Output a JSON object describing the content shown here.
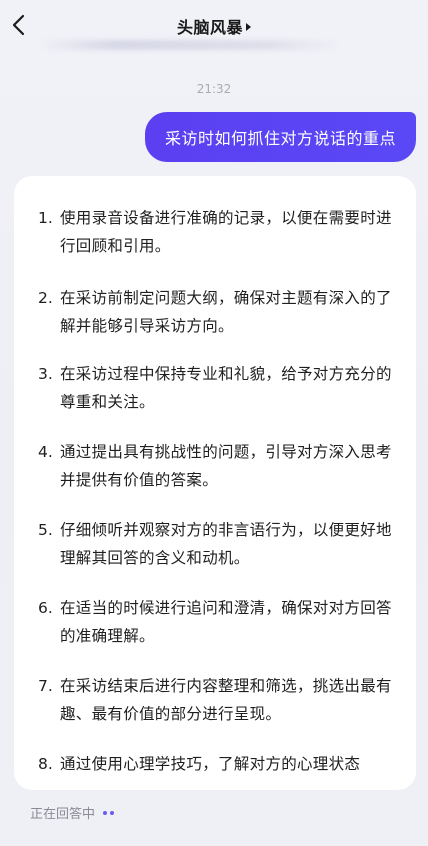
{
  "header": {
    "title": "头脑风暴"
  },
  "timestamp": "21:32",
  "user_message": "采访时如何抓住对方说话的重点",
  "answer": {
    "items": [
      {
        "num": "1.",
        "text": "使用录音设备进行准确的记录，以便在需要时进行回顾和引用。"
      },
      {
        "num": "2.",
        "text": "在采访前制定问题大纲，确保对主题有深入的了解并能够引导采访方向。"
      },
      {
        "num": "3.",
        "text": "在采访过程中保持专业和礼貌，给予对方充分的尊重和关注。"
      },
      {
        "num": "4.",
        "text": "通过提出具有挑战性的问题，引导对方深入思考并提供有价值的答案。"
      },
      {
        "num": "5.",
        "text": "仔细倾听并观察对方的非言语行为，以便更好地理解其回答的含义和动机。"
      },
      {
        "num": "6.",
        "text": "在适当的时候进行追问和澄清，确保对对方回答的准确理解。"
      },
      {
        "num": "7.",
        "text": "在采访结束后进行内容整理和筛选，挑选出最有趣、最有价值的部分进行呈现。"
      },
      {
        "num": "8.",
        "text": "通过使用心理学技巧，了解对方的心理状态"
      }
    ]
  },
  "status": {
    "text": "正在回答中"
  },
  "colors": {
    "accent": "#5b3ff1",
    "background": "#f0f1f6",
    "card": "#ffffff"
  }
}
